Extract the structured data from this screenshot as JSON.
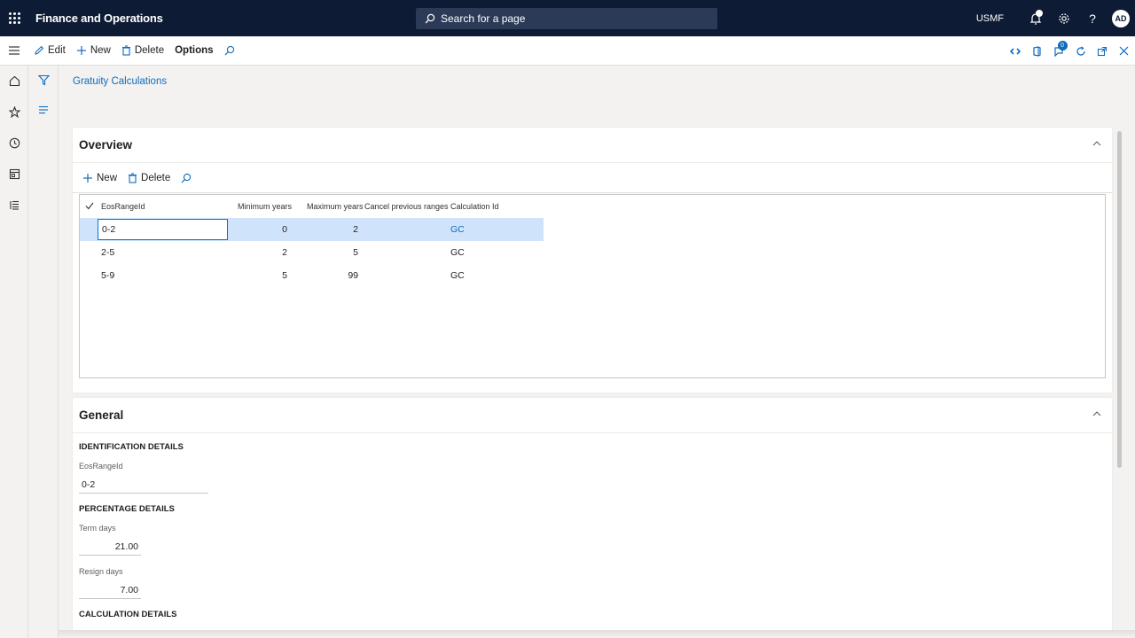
{
  "header": {
    "app_title": "Finance and Operations",
    "search_placeholder": "Search for a page",
    "company": "USMF",
    "avatar_initials": "AD"
  },
  "actionbar": {
    "edit": "Edit",
    "new": "New",
    "delete": "Delete",
    "options": "Options",
    "badge_count": "0"
  },
  "breadcrumb": "Gratuity Calculations",
  "overview": {
    "title": "Overview",
    "toolbar": {
      "new": "New",
      "delete": "Delete"
    },
    "columns": [
      "EosRangeId",
      "Minimum years",
      "Maximum years",
      "Cancel previous ranges",
      "Calculation Id"
    ],
    "rows": [
      {
        "range": "0-2",
        "min": "0",
        "max": "2",
        "calc": "GC"
      },
      {
        "range": "2-5",
        "min": "2",
        "max": "5",
        "calc": "GC"
      },
      {
        "range": "5-9",
        "min": "5",
        "max": "99",
        "calc": "GC"
      }
    ]
  },
  "general": {
    "title": "General",
    "identification_title": "IDENTIFICATION DETAILS",
    "eos_label": "EosRangeId",
    "eos_value": "0-2",
    "percentage_title": "PERCENTAGE DETAILS",
    "term_label": "Term days",
    "term_value": "21.00",
    "resign_label": "Resign days",
    "resign_value": "7.00",
    "calculation_title": "CALCULATION DETAILS"
  },
  "colors": {
    "nav": "#0e1b34",
    "accent": "#0f6cbd",
    "selected_row": "#cfe4fa"
  }
}
